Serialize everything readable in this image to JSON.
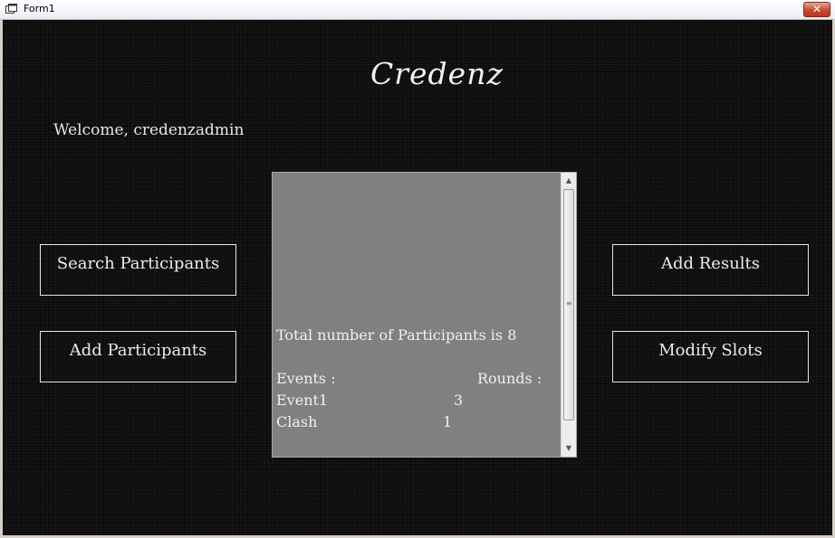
{
  "window": {
    "title": "Form1",
    "close_label": "✕"
  },
  "header": {
    "app_title": "Credenz",
    "welcome": "Welcome, credenzadmin"
  },
  "buttons": {
    "search_participants": "Search Participants",
    "add_participants": "Add Participants",
    "add_results": "Add Results",
    "modify_slots": "Modify Slots"
  },
  "listbox": {
    "total": "Total number of Participants is 8",
    "events_header": "Events :",
    "rounds_header": "Rounds :",
    "rows": [
      {
        "event": "Event1",
        "rounds": "3"
      },
      {
        "event": "Clash",
        "rounds": "1"
      }
    ]
  },
  "colors": {
    "background": "#0c0c0c",
    "listbox": "#808080",
    "text": "#ececec"
  }
}
